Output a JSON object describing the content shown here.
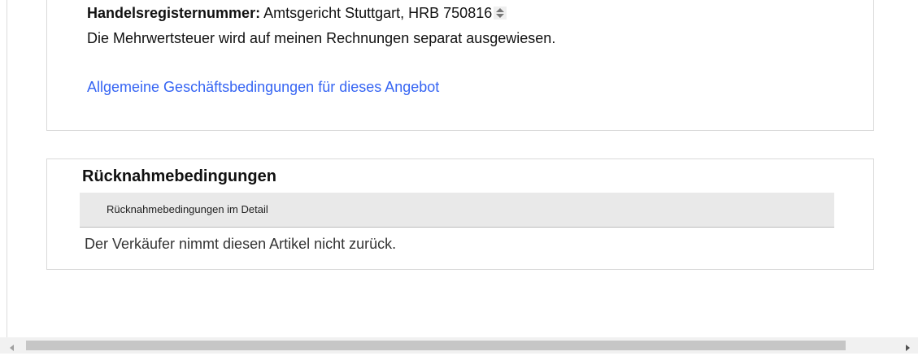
{
  "seller": {
    "register_label": "Handelsregisternummer:",
    "register_value": "Amtsgericht Stuttgart, HRB 750816",
    "vat_note": "Die Mehrwertsteuer wird auf meinen Rechnungen separat ausgewiesen.",
    "terms_link": "Allgemeine Geschäftsbedingungen für dieses Angebot"
  },
  "returns": {
    "title": "Rücknahmebedingungen",
    "detail_header": "Rücknahmebedingungen im Detail",
    "policy_text": "Der Verkäufer nimmt diesen Artikel nicht zurück."
  },
  "colors": {
    "link": "#3665f3",
    "border": "#d9d9d9",
    "detail_bar_bg": "#e9e9e9"
  },
  "icons": {
    "spinner": "up-down-arrows",
    "scroll_left": "triangle-left",
    "scroll_right": "triangle-right"
  }
}
